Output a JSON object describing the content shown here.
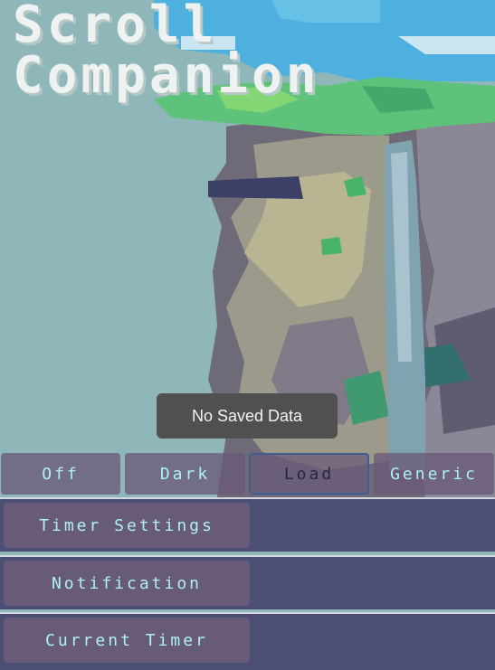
{
  "app": {
    "title_line1": "Scroll",
    "title_line2": "Companion"
  },
  "toast": {
    "message": "No Saved Data"
  },
  "mode_buttons": [
    {
      "label": "Off"
    },
    {
      "label": "Dark"
    },
    {
      "label": "Load",
      "active": true
    },
    {
      "label": "Generic"
    }
  ],
  "panels": {
    "timer_settings": "Timer Settings",
    "notification": "Notification",
    "current_timer": "Current Timer"
  },
  "colors": {
    "panel_bg": "#4b4f74",
    "button_bg": "#675b79",
    "button_text": "#aef1f0",
    "sky": "#8fb7b9"
  }
}
